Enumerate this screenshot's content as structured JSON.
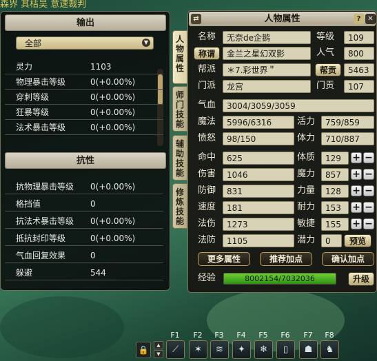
{
  "background_text": "森界 其桔吴 意速裁判",
  "output_panel": {
    "title": "输出",
    "filter_selected": "全部",
    "rows": [
      {
        "label": "灵力",
        "value": "1103"
      },
      {
        "label": "物理暴击等级",
        "value": "0(+0.00%)"
      },
      {
        "label": "穿刺等级",
        "value": "0(+0.00%)"
      },
      {
        "label": "狂暴等级",
        "value": "0(+0.00%)"
      },
      {
        "label": "法术暴击等级",
        "value": "0(+0.00%)"
      }
    ]
  },
  "resist_panel": {
    "title": "抗性",
    "rows": [
      {
        "label": "抗物理暴击等级",
        "value": "0(+0.00%)"
      },
      {
        "label": "格挡值",
        "value": "0"
      },
      {
        "label": "抗法术暴击等级",
        "value": "0(+0.00%)"
      },
      {
        "label": "抵抗封印等级",
        "value": "0(+0.00%)"
      },
      {
        "label": "气血回复效果",
        "value": "0"
      },
      {
        "label": "躲避",
        "value": "544"
      }
    ]
  },
  "side_tabs": [
    {
      "label": "人物属性"
    },
    {
      "label": "师门技能"
    },
    {
      "label": "辅助技能"
    },
    {
      "label": "修炼技能"
    }
  ],
  "char": {
    "title": "人物属性",
    "header_left_icon": "⇄",
    "help_icon": "?",
    "close_icon": "✕",
    "name_label": "名称",
    "name": "无奈de企鹅",
    "level_label": "等级",
    "level": "109",
    "title_btn": "称谓",
    "char_title": "金兰之星幻双影",
    "popularity_label": "人气",
    "popularity": "800",
    "faction_label": "帮派",
    "faction": "＊7.彩世界＂",
    "contribution_btn": "帮贡",
    "contribution": "5463",
    "sect_label": "门派",
    "sect": "龙宫",
    "sect_contrib_label": "门贡",
    "sect_contrib": "107",
    "hp_label": "气血",
    "hp": "3004/3059/3059",
    "mp_label": "魔法",
    "mp": "5996/6316",
    "vitality_label": "活力",
    "vitality": "759/859",
    "anger_label": "愤怒",
    "anger": "98/150",
    "stamina_label": "体力",
    "stamina": "710/887",
    "stats": [
      {
        "label": "命中",
        "value": "625"
      },
      {
        "label": "伤害",
        "value": "1046"
      },
      {
        "label": "防御",
        "value": "831"
      },
      {
        "label": "速度",
        "value": "181"
      },
      {
        "label": "法伤",
        "value": "1273"
      },
      {
        "label": "法防",
        "value": "1105"
      }
    ],
    "attrs": [
      {
        "label": "体质",
        "value": "129"
      },
      {
        "label": "魔力",
        "value": "857"
      },
      {
        "label": "力量",
        "value": "128"
      },
      {
        "label": "耐力",
        "value": "153"
      },
      {
        "label": "敏捷",
        "value": "155"
      },
      {
        "label": "潜力",
        "value": "0"
      }
    ],
    "plus": "+",
    "minus": "−",
    "preview_btn": "预览",
    "more_btn": "更多属性",
    "recommend_btn": "推荐加点",
    "confirm_btn": "确认加点",
    "exp_label": "经验",
    "exp_text": "8002154/7032036",
    "exp_fill": 1.0,
    "upgrade_btn": "升级"
  },
  "hotkeys": {
    "keys": [
      "F1",
      "F2",
      "F3",
      "F4",
      "F5",
      "F6",
      "F7",
      "F8"
    ],
    "icons": [
      "slash-skill-icon",
      "dragon-skill-icon",
      "wave-skill-icon",
      "ice-skill-icon",
      "frost-skill-icon",
      "item-icon",
      "beast-skill-icon",
      "spirit-skill-icon"
    ],
    "glyphs": [
      "⟋",
      "✶",
      "≋",
      "✦",
      "❄",
      "▯",
      "☗",
      "♞"
    ],
    "lock_glyph": "🔒"
  }
}
